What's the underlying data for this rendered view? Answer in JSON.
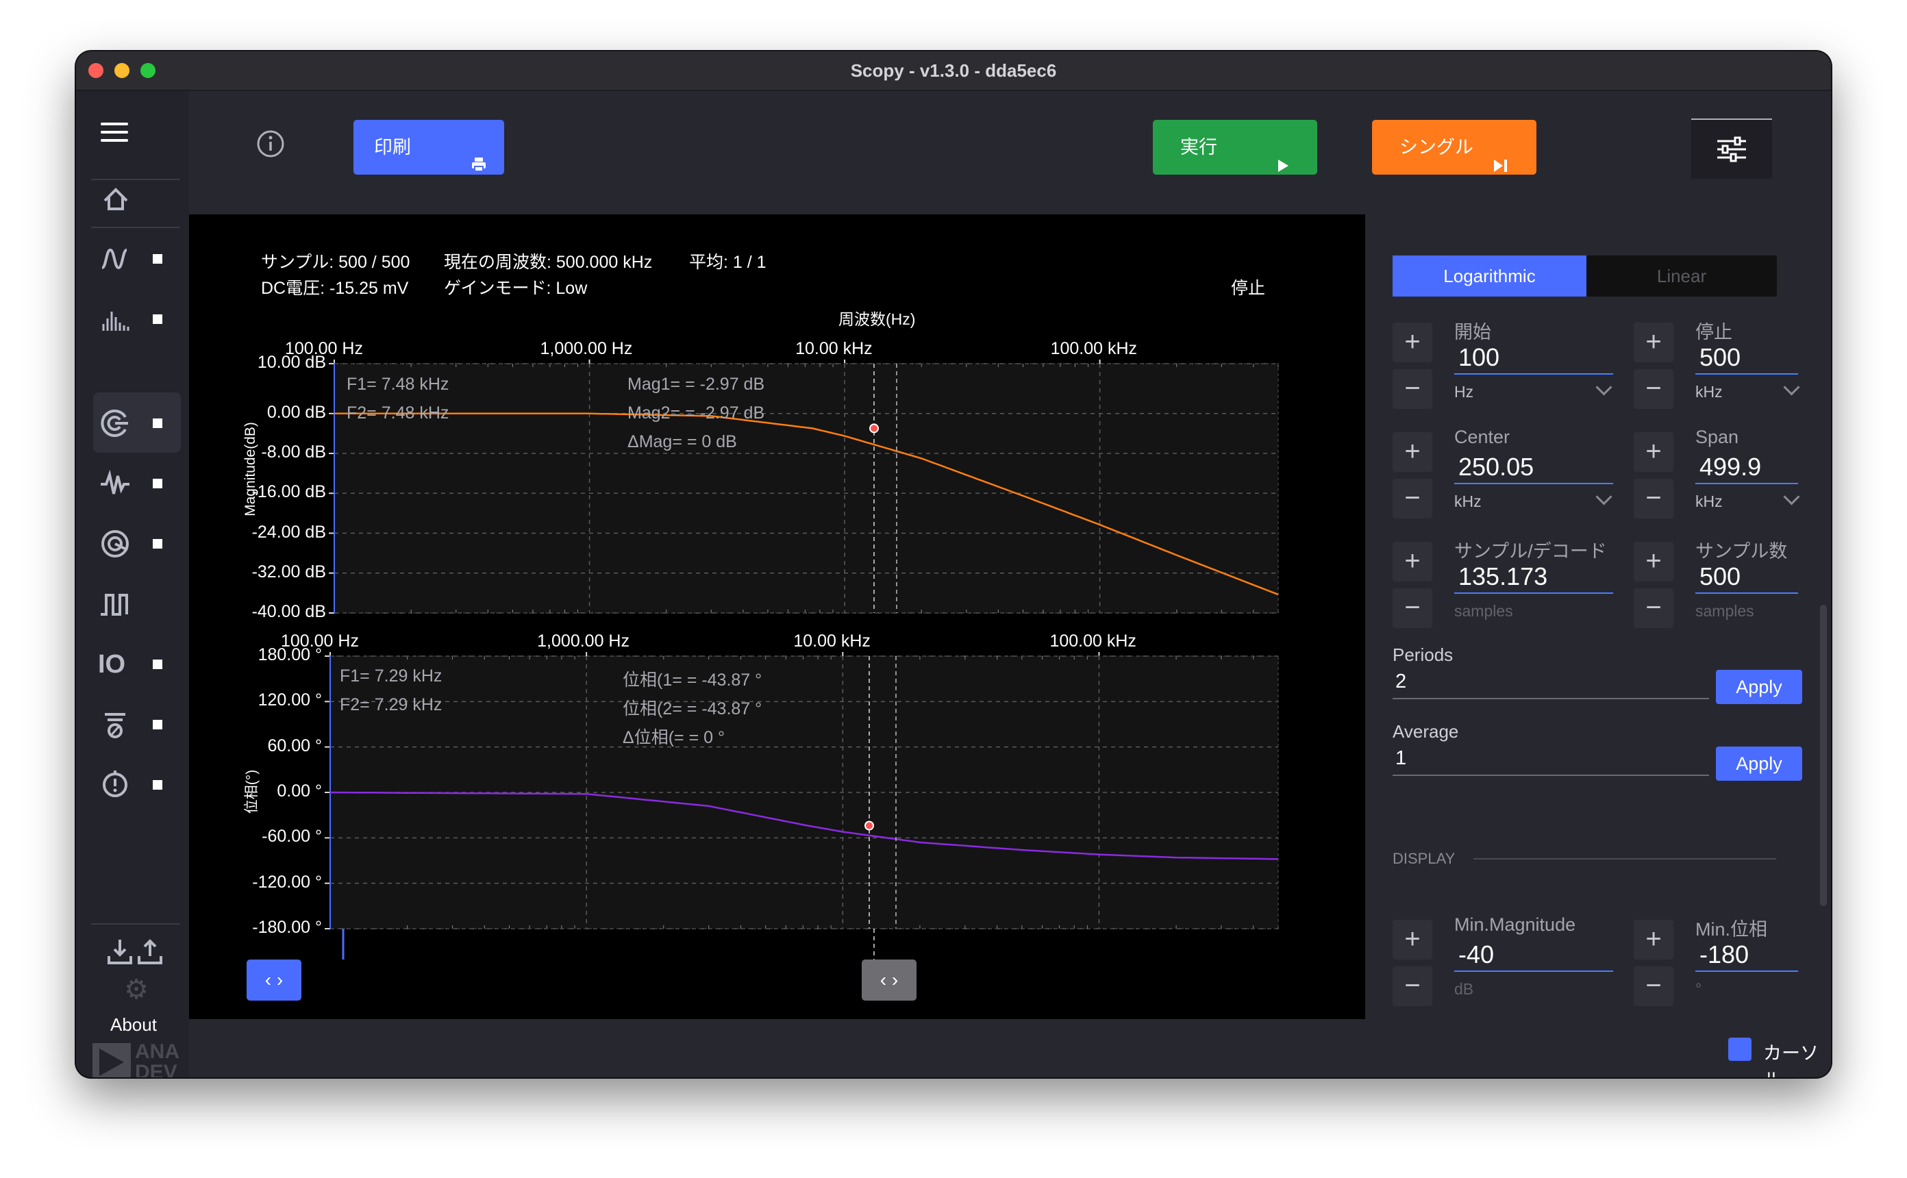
{
  "window": {
    "title": "Scopy - v1.3.0 - dda5ec6"
  },
  "toolbar": {
    "print_label": "印刷",
    "run_label": "実行",
    "single_label": "シングル",
    "run_color": "#24a148",
    "single_color": "#ff7a1a",
    "print_color": "#4a6cff"
  },
  "sidebar": {
    "about_label": "About",
    "logo_text_1": "ANA",
    "logo_text_2": "DEV",
    "items": [
      {
        "icon": "oscilloscope-icon"
      },
      {
        "icon": "spectrum-analyzer-icon"
      },
      {
        "icon": "network-analyzer-icon"
      },
      {
        "icon": "signal-generator-icon"
      },
      {
        "icon": "logic-analyzer-icon"
      },
      {
        "icon": "pattern-generator-icon"
      },
      {
        "icon": "digital-io-icon"
      },
      {
        "icon": "power-supply-icon"
      },
      {
        "icon": "voltmeter-icon"
      }
    ]
  },
  "status": {
    "samples": "サンプル: 500 / 500",
    "current_freq": "現在の周波数: 500.000 kHz",
    "average": "平均: 1 / 1",
    "dc_voltage": "DC電圧: -15.25 mV",
    "gain_mode": "ゲインモード: Low",
    "run_state": "停止"
  },
  "magnitude_plot": {
    "title": "周波数(Hz)",
    "ylabel": "Magnitude(dB)",
    "y_ticks": [
      "10.00 dB",
      "0.00 dB",
      "-8.00 dB",
      "-16.00 dB",
      "-24.00 dB",
      "-32.00 dB",
      "-40.00 dB"
    ],
    "x_ticks": [
      "100.00 Hz",
      "1,000.00 Hz",
      "10.00 kHz",
      "100.00 kHz"
    ],
    "cursor": {
      "f1": "F1=  7.48 kHz",
      "f2": "F2=  7.48 kHz",
      "mag1": "Mag1=  = -2.97 dB",
      "mag2": "Mag2=  = -2.97 dB",
      "dmag": "ΔMag=  = 0 dB"
    }
  },
  "phase_plot": {
    "ylabel": "位相(°)",
    "y_ticks": [
      "180.00 °",
      "120.00 °",
      "60.00 °",
      "0.00 °",
      "-60.00 °",
      "-120.00 °",
      "-180.00 °"
    ],
    "x_ticks": [
      "100.00 Hz",
      "1,000.00 Hz",
      "10.00 kHz",
      "100.00 kHz"
    ],
    "cursor": {
      "f1": "F1=  7.29 kHz",
      "f2": "F2=  7.29 kHz",
      "ph1": "位相(1=  = -43.87 °",
      "ph2": "位相(2=  = -43.87 °",
      "dph": "Δ位相(=  = 0 °"
    }
  },
  "chart_data": [
    {
      "type": "line",
      "xscale": "log",
      "xlim": [
        100,
        500000
      ],
      "ylim": [
        -40,
        10
      ],
      "series": [
        {
          "color": "#ff7f0e",
          "x": [
            100,
            1000,
            3000,
            7480,
            10000,
            20000,
            50000,
            100000,
            200000,
            500000
          ],
          "y": [
            0,
            0,
            -0.5,
            -2.97,
            -4.5,
            -9,
            -16.5,
            -22.3,
            -28.4,
            -36.3
          ]
        }
      ]
    },
    {
      "type": "line",
      "xscale": "log",
      "xlim": [
        100,
        500000
      ],
      "ylim": [
        -180,
        180
      ],
      "series": [
        {
          "color": "#8a2be2",
          "x": [
            100,
            1000,
            3000,
            7290,
            10000,
            20000,
            50000,
            100000,
            200000,
            500000
          ],
          "y": [
            0,
            -2,
            -18,
            -43.87,
            -52,
            -66,
            -76,
            -82,
            -86,
            -88
          ]
        }
      ]
    }
  ],
  "settings": {
    "scale_tabs": [
      "Logarithmic",
      "Linear"
    ],
    "start": {
      "label": "開始",
      "value": "100",
      "unit": "Hz"
    },
    "stop": {
      "label": "停止",
      "value": "500",
      "unit": "kHz"
    },
    "center": {
      "label": "Center",
      "value": "250.05",
      "unit": "kHz"
    },
    "span": {
      "label": "Span",
      "value": "499.9",
      "unit": "kHz"
    },
    "samples_per_decade": {
      "label": "サンプル/デコード",
      "value": "135.173",
      "unit": "samples"
    },
    "sample_count": {
      "label": "サンプル数",
      "value": "500",
      "unit": "samples"
    },
    "periods": {
      "label": "Periods",
      "value": "2",
      "apply": "Apply"
    },
    "average": {
      "label": "Average",
      "value": "1",
      "apply": "Apply"
    },
    "display_section": "DISPLAY",
    "min_magnitude": {
      "label": "Min.Magnitude",
      "value": "-40",
      "unit": "dB"
    },
    "min_phase": {
      "label": "Min.位相",
      "value": "-180",
      "unit": "°"
    }
  },
  "bottom": {
    "cursor_label": "カーソル"
  }
}
